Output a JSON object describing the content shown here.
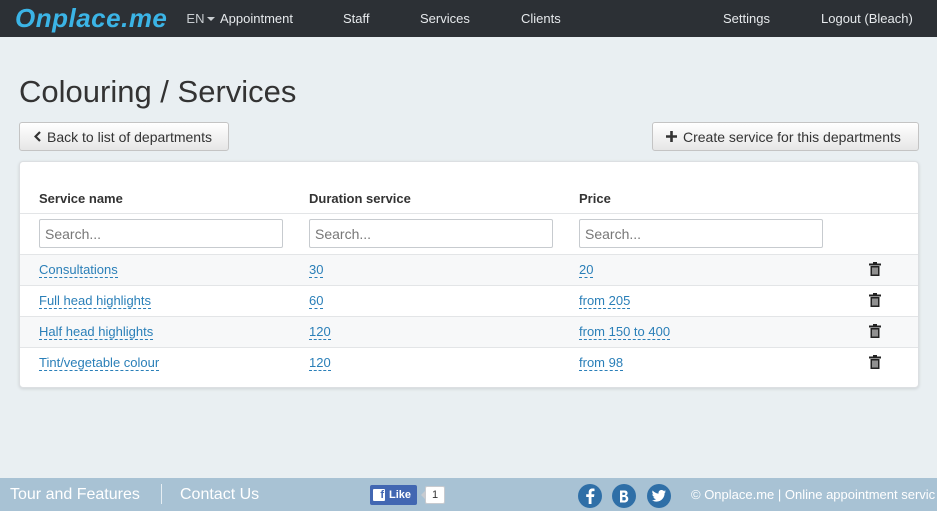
{
  "nav": {
    "brand": "Onplace.me",
    "lang": "EN",
    "items": [
      "Appointment",
      "Staff",
      "Services",
      "Clients"
    ],
    "settings": "Settings",
    "logout": "Logout (Bleach)"
  },
  "page": {
    "title": "Colouring / Services",
    "back_button": "Back to list of departments",
    "create_button": "Create service for this departments"
  },
  "table": {
    "headers": [
      "Service name",
      "Duration service",
      "Price"
    ],
    "placeholders": [
      "Search...",
      "Search...",
      "Search..."
    ],
    "rows": [
      {
        "name": "Consultations",
        "duration": "30",
        "price": "20"
      },
      {
        "name": "Full head highlights",
        "duration": "60",
        "price": "from 205"
      },
      {
        "name": "Half head highlights",
        "duration": "120",
        "price": "from 150 to 400"
      },
      {
        "name": "Tint/vegetable colour",
        "duration": "120",
        "price": "from 98"
      }
    ]
  },
  "footer": {
    "tour": "Tour and Features",
    "contact": "Contact Us",
    "like_label": "Like",
    "like_count": "1",
    "copyright": "© Onplace.me | Online appointment servic"
  },
  "colors": {
    "brand": "#3bb4e6",
    "link": "#2a7fb8",
    "navbar": "#2c3035",
    "footer": "#a8c2d4"
  }
}
